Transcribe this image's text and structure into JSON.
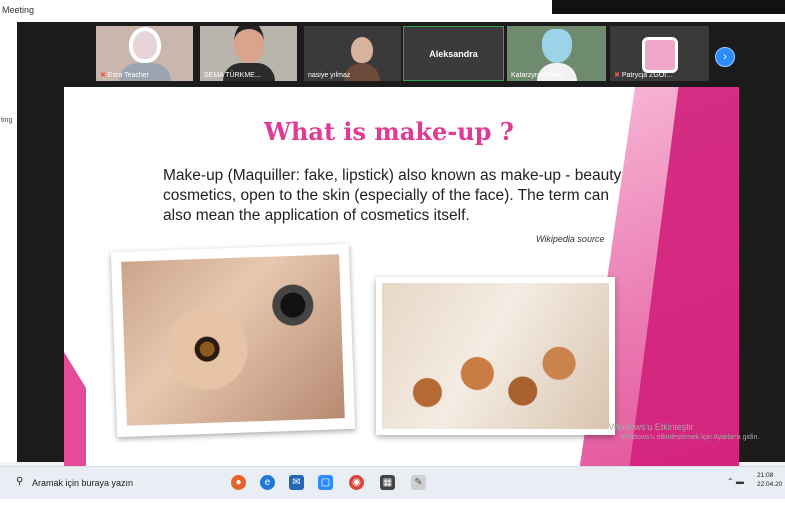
{
  "window": {
    "title": "Meeting",
    "side_label": "ting",
    "minimize": "–",
    "close": "□"
  },
  "participants": [
    {
      "name": "Esra Teacher",
      "muted": true
    },
    {
      "name": "SEMA TÜRKME...",
      "muted": false
    },
    {
      "name": "nasiye yılmaz",
      "muted": false
    },
    {
      "name": "Aleksandra",
      "muted": false
    },
    {
      "name": "Katarzyna Kowa...",
      "muted": false
    },
    {
      "name": "Patrycja ZGOI...",
      "muted": true
    }
  ],
  "next_icon": "›",
  "slide": {
    "title": "What is make-up ?",
    "body": "Make-up (Maquiller: fake, lipstick) also known as make-up - beauty cosmetics, open to the skin (especially of the face). The term can also mean the application of cosmetics itself.",
    "source": "Wikipedia source"
  },
  "watermark": {
    "line1": "Windows'u Etkinleştir",
    "line2": "Windows'u etkinleştirmek için Ayarlar'a gidin."
  },
  "taskbar": {
    "search_placeholder": "Aramak için buraya yazın",
    "time": "21:08",
    "date": "22.04.20"
  },
  "icons": {
    "search": "search-icon",
    "tray": "tray-icon"
  }
}
